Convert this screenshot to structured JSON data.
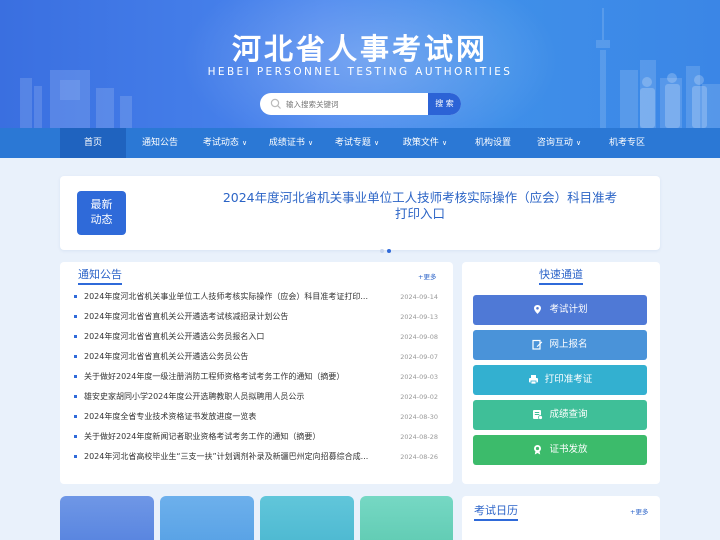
{
  "header": {
    "title": "河北省人事考试网",
    "subtitle": "HEBEI PERSONNEL TESTING AUTHORITIES"
  },
  "search": {
    "placeholder": "输入搜索关键词",
    "button_label": "搜 索"
  },
  "nav": {
    "items": [
      {
        "label": "首页",
        "dropdown": false,
        "active": true
      },
      {
        "label": "通知公告",
        "dropdown": false
      },
      {
        "label": "考试动态",
        "dropdown": true
      },
      {
        "label": "成绩证书",
        "dropdown": true
      },
      {
        "label": "考试专题",
        "dropdown": true
      },
      {
        "label": "政策文件",
        "dropdown": true
      },
      {
        "label": "机构设置",
        "dropdown": false
      },
      {
        "label": "咨询互动",
        "dropdown": true
      },
      {
        "label": "机考专区",
        "dropdown": false
      }
    ],
    "caret": "∨"
  },
  "latest": {
    "tag_line1": "最新",
    "tag_line2": "动态",
    "headline_line1": "2024年度河北省机关事业单位工人技师考核实际操作（应会）科目准考",
    "headline_line2": "打印入口"
  },
  "notices": {
    "title": "通知公告",
    "more": "+更多",
    "items": [
      {
        "text": "2024年度河北省机关事业单位工人技师考核实际操作（应会）科目准考证打印...",
        "date": "2024-09-14"
      },
      {
        "text": "2024年度河北省省直机关公开遴选考试核减招录计划公告",
        "date": "2024-09-13"
      },
      {
        "text": "2024年度河北省省直机关公开遴选公务员报名入口",
        "date": "2024-09-08"
      },
      {
        "text": "2024年度河北省省直机关公开遴选公务员公告",
        "date": "2024-09-07"
      },
      {
        "text": "关于做好2024年度一级注册消防工程师资格考试考务工作的通知（摘要）",
        "date": "2024-09-03"
      },
      {
        "text": "雄安史家胡同小学2024年度公开选聘教职人员拟聘用人员公示",
        "date": "2024-09-02"
      },
      {
        "text": "2024年度全省专业技术资格证书发放进度一览表",
        "date": "2024-08-30"
      },
      {
        "text": "关于做好2024年度新闻记者职业资格考试考务工作的通知（摘要）",
        "date": "2024-08-28"
      },
      {
        "text": "2024年河北省高校毕业生“三支一扶”计划调剂补录及新疆巴州定向招募综合成...",
        "date": "2024-08-26"
      }
    ]
  },
  "quick": {
    "title": "快速通道",
    "buttons": [
      {
        "label": "考试计划",
        "icon": "map-pin-icon",
        "color": "#4f79d6"
      },
      {
        "label": "网上报名",
        "icon": "edit-icon",
        "color": "#4a93d9"
      },
      {
        "label": "打印准考证",
        "icon": "printer-icon",
        "color": "#33b0d0"
      },
      {
        "label": "成绩查询",
        "icon": "scores-icon",
        "color": "#3fbf98"
      },
      {
        "label": "证书发放",
        "icon": "certificate-icon",
        "color": "#3cbb6b"
      }
    ]
  },
  "calendar": {
    "title": "考试日历",
    "more": "+更多"
  },
  "colors": {
    "brand": "#2f6ad9",
    "nav": "#2b78d5",
    "nav_active": "#1f63bf"
  }
}
